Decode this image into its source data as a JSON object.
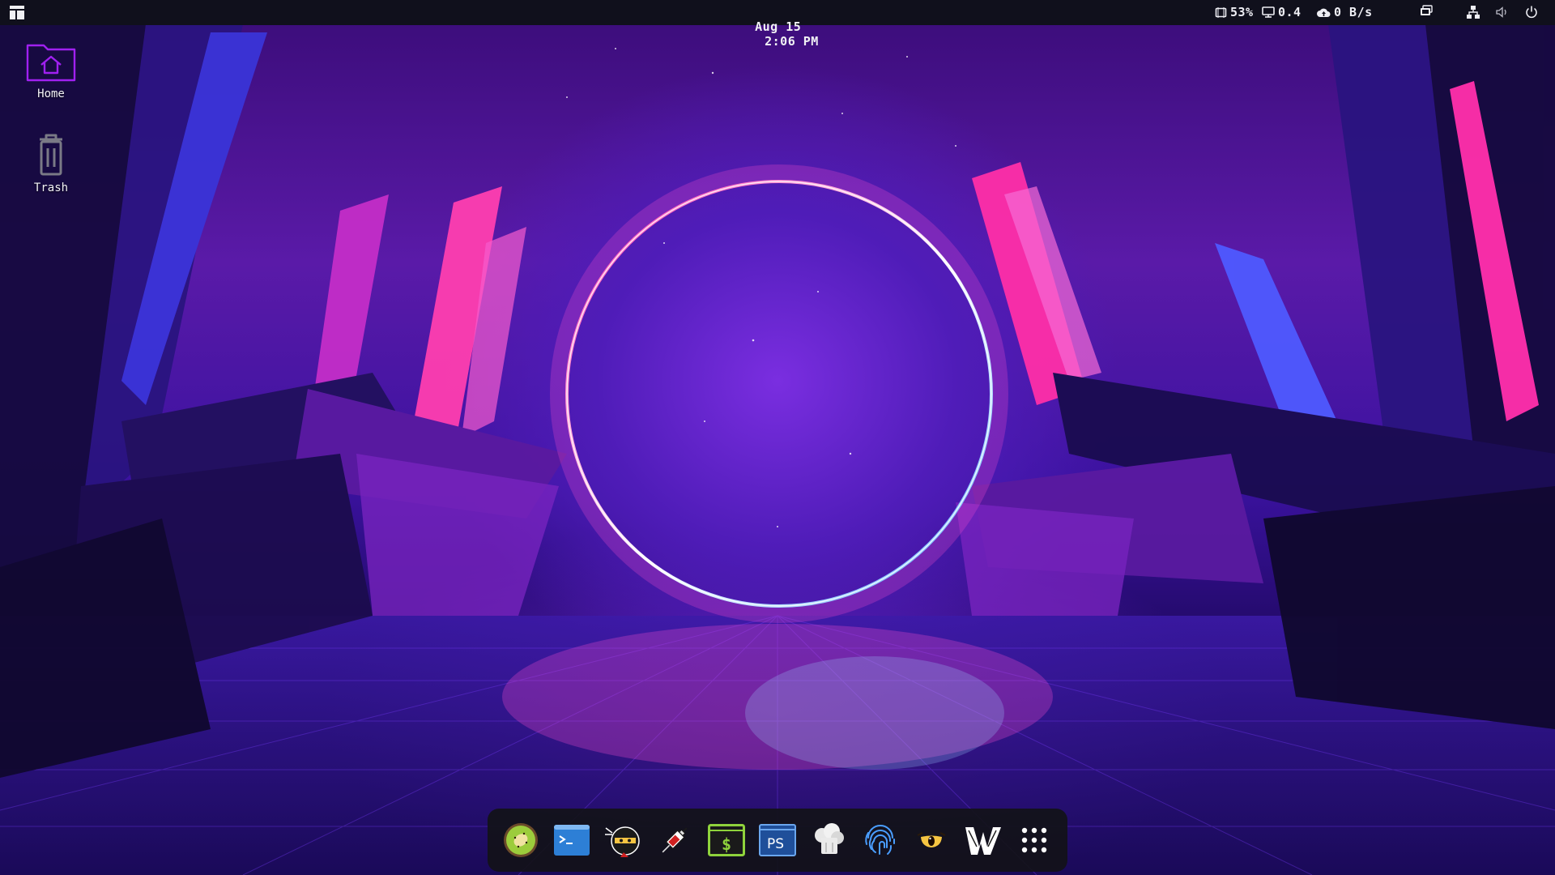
{
  "topbar": {
    "date": "Aug 15",
    "time": "2:06 PM",
    "cpu_percent": "53%",
    "load": "0.4",
    "net_speed": "0 B/s"
  },
  "desktop": {
    "icons": [
      {
        "label": "Home",
        "icon": "home-folder-icon"
      },
      {
        "label": "Trash",
        "icon": "trash-icon"
      }
    ]
  },
  "dock": {
    "items": [
      {
        "icon": "kiwi-icon"
      },
      {
        "icon": "terminal-icon"
      },
      {
        "icon": "ninja-icon"
      },
      {
        "icon": "syringe-icon"
      },
      {
        "icon": "shell-terminal-icon"
      },
      {
        "icon": "powershell-icon"
      },
      {
        "icon": "chef-hat-icon"
      },
      {
        "icon": "fingerprint-icon"
      },
      {
        "icon": "eye-icon"
      },
      {
        "icon": "wordpress-scan-icon"
      },
      {
        "icon": "app-grid-icon"
      }
    ]
  },
  "colors": {
    "topbar_bg": "#10101c",
    "dock_bg": "#121218",
    "ring_pink": "#ff2fa8",
    "ring_blue": "#4aa8ff",
    "accent_purple": "#a020f0"
  }
}
